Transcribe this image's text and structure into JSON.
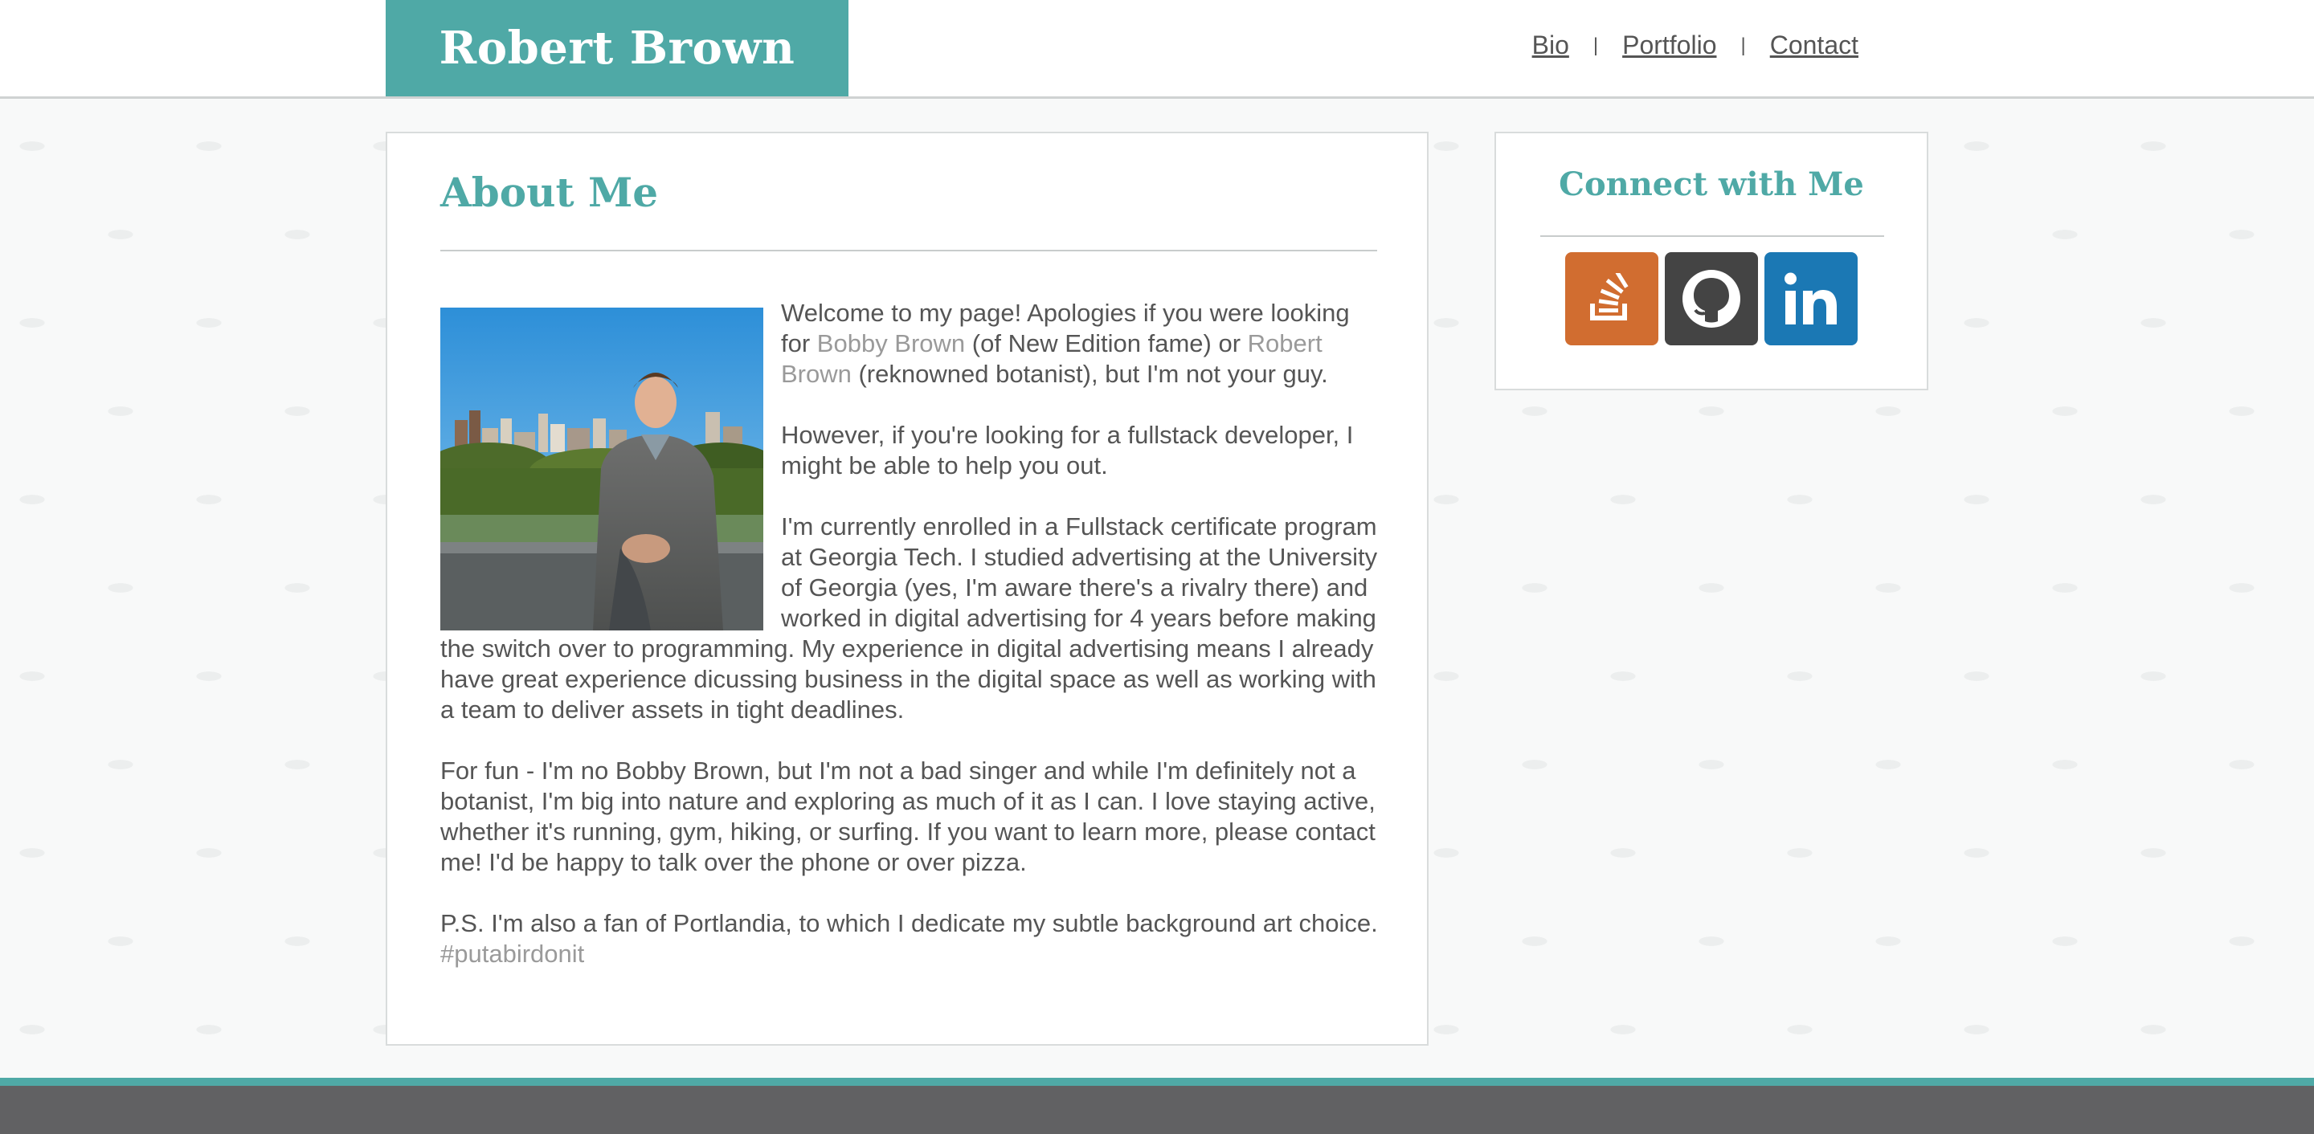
{
  "header": {
    "brand_title": "Robert Brown",
    "nav": [
      {
        "label": "Bio"
      },
      {
        "label": "Portfolio"
      },
      {
        "label": "Contact"
      }
    ],
    "nav_separator": "|"
  },
  "about": {
    "title": "About Me",
    "p1": {
      "before": "Welcome to my page! Apologies if you were looking for ",
      "link1": "Bobby Brown",
      "middle": " (of New Edition fame) or ",
      "link2": "Robert Brown",
      "after": " (reknowned botanist), but I'm not your guy."
    },
    "p2": "However, if you're looking for a fullstack developer, I might be able to help you out.",
    "p3": "I'm currently enrolled in a Fullstack certificate program at Georgia Tech. I studied advertising at the University of Georgia (yes, I'm aware there's a rivalry there) and worked in digital advertising for 4 years before making the switch over to programming. My experience in digital advertising means I already have great experience dicussing business in the digital space as well as working with a team to deliver assets in tight deadlines.",
    "p4": "For fun - I'm no Bobby Brown, but I'm not a bad singer and while I'm definitely not a botanist, I'm big into nature and exploring as much of it as I can. I love staying active, whether it's running, gym, hiking, or surfing. If you want to learn more, please contact me! I'd be happy to talk over the phone or over pizza.",
    "p5": {
      "text": "P.S. I'm also a fan of Portlandia, to which I dedicate my subtle background art choice. ",
      "hashtag": "#putabirdonit"
    }
  },
  "connect": {
    "title": "Connect with Me",
    "links": [
      {
        "icon": "stack-overflow-icon",
        "color": "#d16d30"
      },
      {
        "icon": "github-icon",
        "color": "#444444"
      },
      {
        "icon": "linkedin-icon",
        "color": "#1b78b4"
      }
    ]
  },
  "colors": {
    "accent": "#4fa9a6",
    "text": "#555555",
    "link_muted": "#9a9a9a",
    "footer": "#616163"
  }
}
